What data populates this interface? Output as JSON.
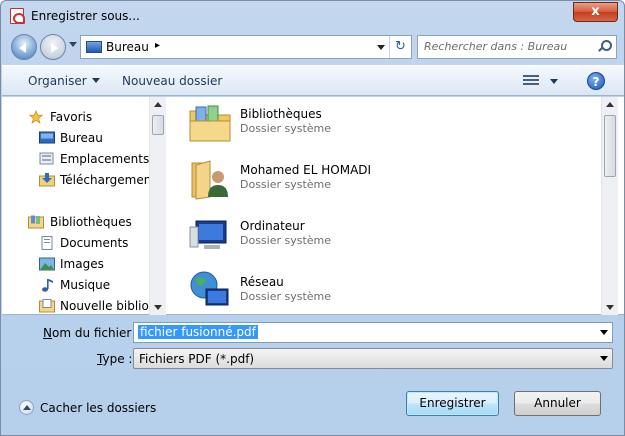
{
  "window": {
    "title": "Enregistrer sous...",
    "close_glyph": "x"
  },
  "nav": {
    "address_location": "Bureau",
    "address_chevron": "▸",
    "refresh_glyph": "↻",
    "search_placeholder": "Rechercher dans : Bureau"
  },
  "toolbar": {
    "organise_label": "Organiser",
    "new_folder_label": "Nouveau dossier",
    "help_glyph": "?"
  },
  "sidebar": {
    "items": [
      {
        "label": "Favoris",
        "icon": "star-icon"
      },
      {
        "label": "Bureau",
        "icon": "desktop-icon"
      },
      {
        "label": "Emplacements ré",
        "icon": "recent-places-icon"
      },
      {
        "label": "Téléchargements",
        "icon": "downloads-icon"
      },
      {
        "label": "Bibliothèques",
        "icon": "libraries-icon"
      },
      {
        "label": "Documents",
        "icon": "documents-icon"
      },
      {
        "label": "Images",
        "icon": "images-icon"
      },
      {
        "label": "Musique",
        "icon": "music-icon"
      },
      {
        "label": "Nouvelle biblioth",
        "icon": "new-library-icon"
      }
    ]
  },
  "files": [
    {
      "name": "Bibliothèques",
      "type": "Dossier système",
      "icon": "libraries-folder-icon"
    },
    {
      "name": "Mohamed EL HOMADI",
      "type": "Dossier système",
      "icon": "user-folder-icon"
    },
    {
      "name": "Ordinateur",
      "type": "Dossier système",
      "icon": "computer-icon"
    },
    {
      "name": "Réseau",
      "type": "Dossier système",
      "icon": "network-icon"
    }
  ],
  "form": {
    "filename_label_prefix": "N",
    "filename_label_rest": "om du fichier :",
    "filename_value": "fichier fusionné.pdf",
    "type_label_prefix": "T",
    "type_label_rest": "ype :",
    "type_value": "Fichiers PDF (*.pdf)"
  },
  "footer": {
    "hide_folders_label": "Cacher les dossiers",
    "save_label": "Enregistrer",
    "cancel_label": "Annuler"
  }
}
